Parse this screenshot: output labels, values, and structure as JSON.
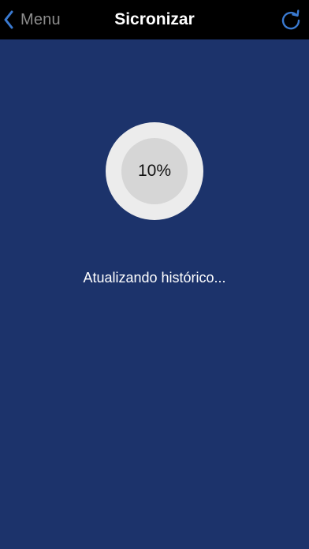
{
  "nav": {
    "back_label": "Menu",
    "back_icon": "chevron-left-icon",
    "title": "Sicronizar",
    "refresh_icon": "refresh-icon"
  },
  "sync": {
    "progress_label": "10%",
    "progress_fraction": 0.1,
    "status": "Atualizando histórico..."
  },
  "colors": {
    "background": "#1c336b",
    "navbar": "#000000",
    "accent": "#3a7ad1",
    "ring_outer": "#ececec",
    "ring_inner": "#d6d6d6"
  }
}
